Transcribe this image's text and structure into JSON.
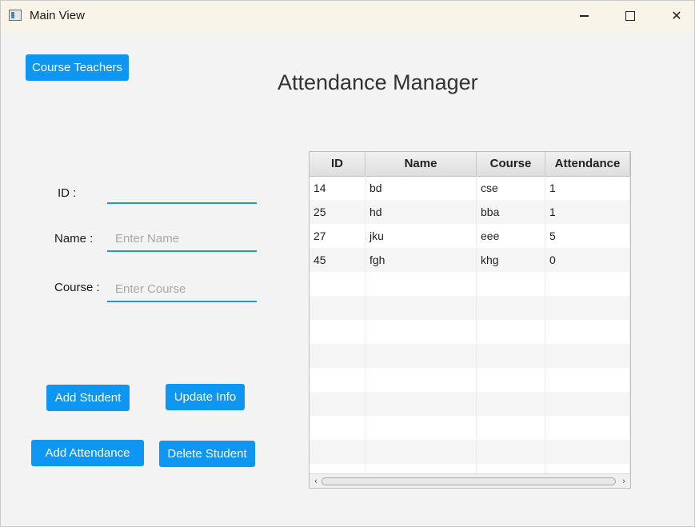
{
  "window": {
    "title": "Main View",
    "controls": {
      "minimize": "minimize-icon",
      "maximize": "maximize-icon",
      "close": "✕"
    }
  },
  "main": {
    "heading": "Attendance Manager",
    "course_teachers_button": "Course Teachers"
  },
  "form": {
    "id_label": "ID :",
    "id_value": "",
    "name_label": "Name :",
    "name_placeholder": "Enter Name",
    "course_label": "Course :",
    "course_placeholder": "Enter Course"
  },
  "actions": {
    "add_student": "Add Student",
    "update_info": "Update Info",
    "add_attendance": "Add Attendance",
    "delete_student": "Delete Student"
  },
  "table": {
    "columns": [
      "ID",
      "Name",
      "Course",
      "Attendance"
    ],
    "rows": [
      [
        "14",
        "bd",
        "cse",
        "1"
      ],
      [
        "25",
        "hd",
        "bba",
        "1"
      ],
      [
        "27",
        "jku",
        "eee",
        "5"
      ],
      [
        "45",
        "fgh",
        "khg",
        "0"
      ],
      [
        "",
        "",
        "",
        ""
      ],
      [
        "",
        "",
        "",
        ""
      ],
      [
        "",
        "",
        "",
        ""
      ],
      [
        "",
        "",
        "",
        ""
      ],
      [
        "",
        "",
        "",
        ""
      ],
      [
        "",
        "",
        "",
        ""
      ],
      [
        "",
        "",
        "",
        ""
      ],
      [
        "",
        "",
        "",
        ""
      ],
      [
        "",
        "",
        "",
        ""
      ]
    ],
    "scroll_left_icon": "‹",
    "scroll_right_icon": "›"
  },
  "colors": {
    "accent": "#0d96f2",
    "title_bar": "#f8f4e8",
    "background": "#f3f3f3"
  }
}
